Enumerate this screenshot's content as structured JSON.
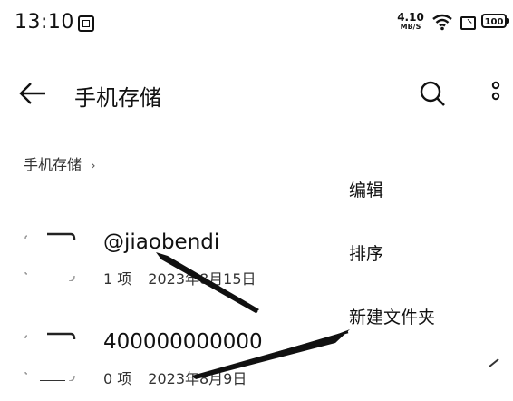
{
  "status_bar": {
    "time": "13:10",
    "net_speed_value": "4.10",
    "net_speed_unit": "MB/S",
    "battery": "100"
  },
  "header": {
    "title": "手机存储"
  },
  "breadcrumb": {
    "label": "手机存储",
    "chevron": "›"
  },
  "files": [
    {
      "name": "@jiaobendi",
      "count": "1 项",
      "date": "2023年8月15日"
    },
    {
      "name": "400000000000",
      "count": "0 项",
      "date": "2023年8月9日"
    }
  ],
  "menu": {
    "items": [
      {
        "label": "编辑"
      },
      {
        "label": "排序"
      },
      {
        "label": "新建文件夹"
      }
    ]
  },
  "icons": {
    "back": "arrow-left-icon",
    "search": "search-icon",
    "more": "more-vertical-icon",
    "folder": "folder-icon"
  },
  "colors": {
    "text": "#111111",
    "background": "#ffffff"
  }
}
